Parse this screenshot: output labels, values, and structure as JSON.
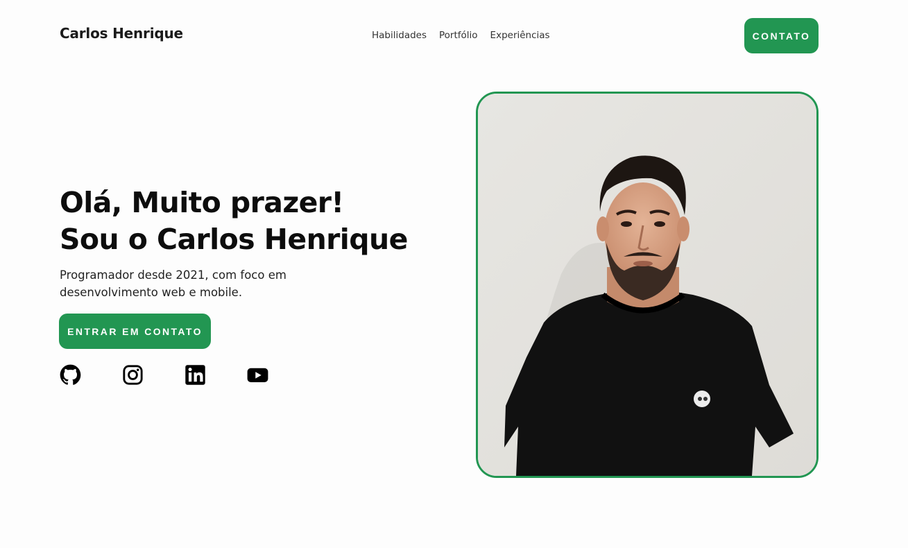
{
  "header": {
    "brand": "Carlos Henrique",
    "nav": [
      {
        "label": "Habilidades"
      },
      {
        "label": "Portfólio"
      },
      {
        "label": "Experiências"
      }
    ],
    "cta_label": "CONTATO"
  },
  "hero": {
    "title_line1": "Olá, Muito prazer!",
    "title_line2": "Sou o Carlos Henrique",
    "subtitle": "Programador desde 2021, com foco em desenvolvimento web e mobile.",
    "cta_label": "ENTRAR EM CONTATO",
    "socials": [
      {
        "icon": "github-icon"
      },
      {
        "icon": "instagram-icon"
      },
      {
        "icon": "linkedin-icon"
      },
      {
        "icon": "youtube-icon"
      }
    ]
  },
  "colors": {
    "accent": "#229652",
    "background": "#fdfdfd",
    "text": "#111111"
  }
}
